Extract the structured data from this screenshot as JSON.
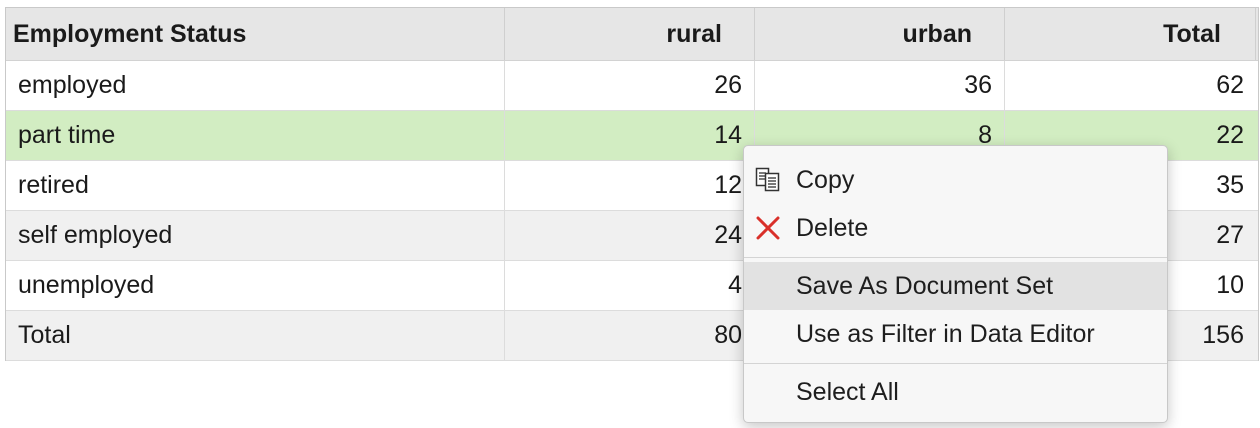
{
  "table": {
    "headers": [
      "Employment Status",
      "rural",
      "urban",
      "Total"
    ],
    "rows": [
      {
        "label": "employed",
        "rural": "26",
        "urban": "36",
        "total": "62"
      },
      {
        "label": "part time",
        "rural": "14",
        "urban": "8",
        "total": "22"
      },
      {
        "label": "retired",
        "rural": "12",
        "urban": "",
        "total": "35"
      },
      {
        "label": "self employed",
        "rural": "24",
        "urban": "",
        "total": "27"
      },
      {
        "label": "unemployed",
        "rural": "4",
        "urban": "",
        "total": "10"
      },
      {
        "label": "Total",
        "rural": "80",
        "urban": "",
        "total": "156"
      }
    ],
    "selected_row": "part time"
  },
  "context_menu": {
    "items": [
      {
        "label": "Copy",
        "icon": "copy-icon"
      },
      {
        "label": "Delete",
        "icon": "delete-x-icon"
      },
      {
        "label": "Save As Document Set",
        "icon": ""
      },
      {
        "label": "Use as Filter in Data Editor",
        "icon": ""
      },
      {
        "label": "Select All",
        "icon": ""
      }
    ],
    "highlighted_item": "Save As Document Set"
  },
  "colors": {
    "selected_row": "#d2edc2",
    "header_bg": "#e6e6e6",
    "alt_row": "#f0f0f0",
    "delete_icon": "#d9302a"
  }
}
